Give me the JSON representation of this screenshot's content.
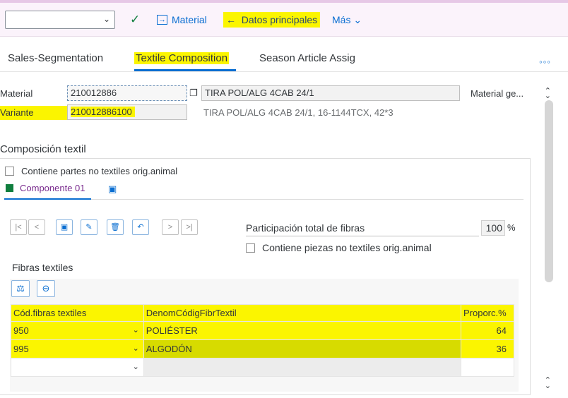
{
  "toolbar": {
    "combo_value": "",
    "material_label": "Material",
    "datos_label": "Datos principales",
    "mas_label": "Más"
  },
  "tabs": [
    {
      "label": "Sales-Segmentation"
    },
    {
      "label": "Textile Composition"
    },
    {
      "label": "Season Article Assig"
    }
  ],
  "more_label": "◦◦◦",
  "header": {
    "material_label": "Material",
    "material_value": "210012886",
    "material_desc": "TIRA POL/ALG 4CAB 24/1",
    "material_ge_label": "Material ge...",
    "variante_label": "Variante",
    "variante_value": "210012886100",
    "variante_desc": "TIRA POL/ALG 4CAB 24/1, 16-1144TCX, 42*3"
  },
  "composicion": {
    "title": "Composición textil",
    "checkbox_label": "Contiene partes no textiles orig.animal",
    "component_tab": "Componente 01"
  },
  "participacion": {
    "label": "Participación total de fibras",
    "value": "100",
    "unit": "%",
    "checkbox_label": "Contiene piezas no textiles orig.animal"
  },
  "fibras": {
    "title": "Fibras textiles",
    "columns": [
      "Cód.fibras textiles",
      "DenomCódigFibrTextil",
      "Proporc.%"
    ],
    "rows": [
      {
        "code": "950",
        "name": "POLIÉSTER",
        "prop": "64"
      },
      {
        "code": "995",
        "name": "ALGODÓN",
        "prop": "36"
      }
    ]
  },
  "colors": {
    "highlight": "#fbf500",
    "accent": "#0a6ed1",
    "tab_purple": "#7a2c8e",
    "success_green": "#107e3e"
  }
}
